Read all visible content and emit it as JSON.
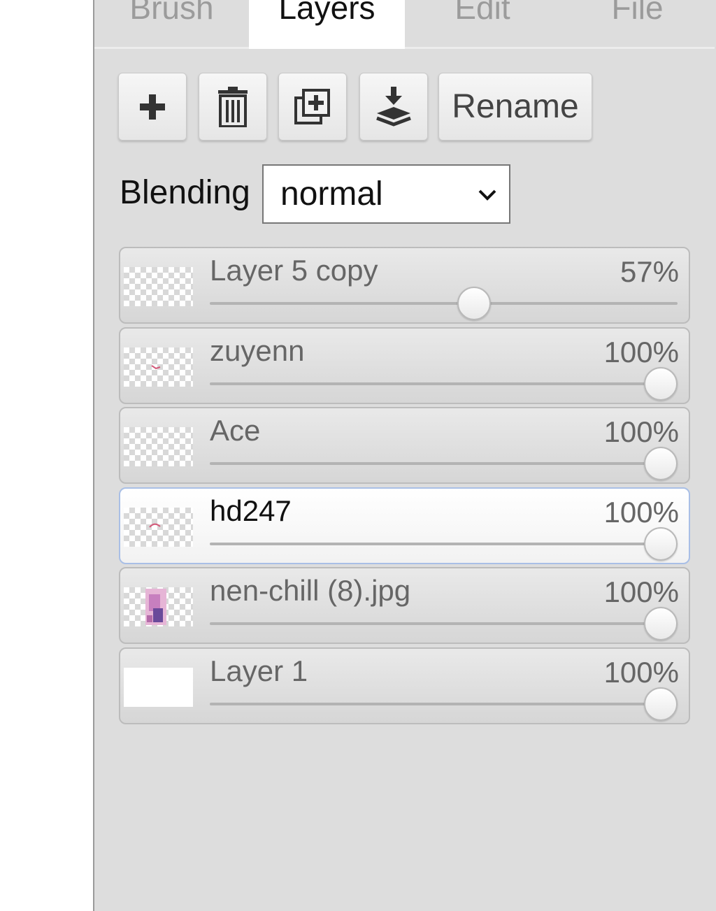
{
  "tabs": [
    {
      "label": "Brush",
      "active": false
    },
    {
      "label": "Layers",
      "active": true
    },
    {
      "label": "Edit",
      "active": false
    },
    {
      "label": "File",
      "active": false
    }
  ],
  "toolbar": {
    "add_icon": "plus-icon",
    "delete_icon": "trash-icon",
    "duplicate_icon": "duplicate-icon",
    "merge_icon": "merge-down-icon",
    "rename_label": "Rename"
  },
  "blending": {
    "label": "Blending",
    "value": "normal"
  },
  "layers": [
    {
      "name": "Layer 5 copy",
      "opacity_label": "57%",
      "opacity": 0.57,
      "selected": false,
      "thumbnail": "transparent"
    },
    {
      "name": "zuyenn",
      "opacity_label": "100%",
      "opacity": 1.0,
      "selected": false,
      "thumbnail": "transparent-with-red-stroke"
    },
    {
      "name": "Ace",
      "opacity_label": "100%",
      "opacity": 1.0,
      "selected": false,
      "thumbnail": "transparent"
    },
    {
      "name": "hd247",
      "opacity_label": "100%",
      "opacity": 1.0,
      "selected": true,
      "thumbnail": "transparent-with-red-stroke"
    },
    {
      "name": "nen-chill (8).jpg",
      "opacity_label": "100%",
      "opacity": 1.0,
      "selected": false,
      "thumbnail": "image"
    },
    {
      "name": "Layer 1",
      "opacity_label": "100%",
      "opacity": 1.0,
      "selected": false,
      "thumbnail": "white"
    }
  ],
  "colors": {
    "panel_bg": "#dddddd",
    "selected_border": "#a9bfe6",
    "text_muted": "#666666",
    "text_dark": "#111111"
  }
}
